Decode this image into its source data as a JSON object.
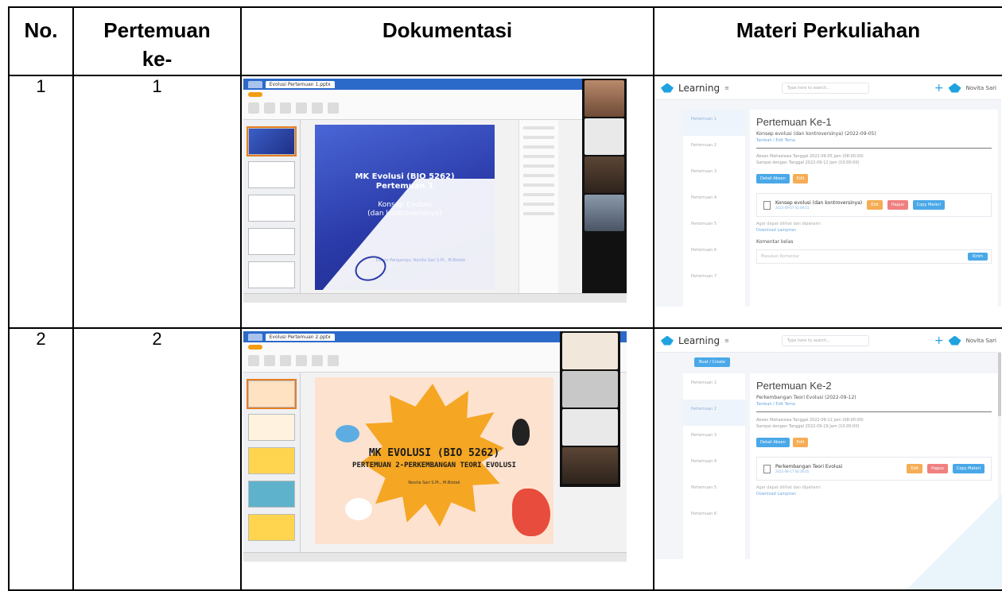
{
  "table": {
    "headers": {
      "no": "No.",
      "pertemuan": "Pertemuan ke-",
      "dokumentasi": "Dokumentasi",
      "materi": "Materi Perkuliahan"
    },
    "rows": [
      {
        "no": "1",
        "pertemuan": "1",
        "dok": {
          "tab_title": "Evolusi Pertemuan 1.pptx",
          "slide_title": "MK Evolusi (BIO 5262)",
          "slide_subtitle": "Pertemuan 1",
          "slide_topic": "Konsep Evolusi",
          "slide_topic2": "(dan kontroversinya)",
          "slide_footer": "Dosen Pengampu: Novita Sari S.Pt., M.Biotek"
        },
        "lms": {
          "brand": "Learning",
          "search_placeholder": "Type here to search...",
          "user": "Novita Sari",
          "heading": "Pertemuan Ke-1",
          "topic": "Konsep evolusi (dan kontroversinya) (2022-09-05)",
          "edit_link": "Tambah / Edit Tema",
          "absen_line1": "Absen Mahasiswa Tanggal 2022-09-05 Jam (08:00:00)",
          "absen_line2": "Sampai dengan Tanggal 2022-09-12 Jam (10:00:00)",
          "btn_detail": "Detail Absen",
          "btn_edit": "Edit",
          "materi_title": "Konsep evolusi (dan kontroversinya)",
          "materi_date": "2022-09-07 05:09:51",
          "btn_edit_materi": "Edit",
          "btn_hapus": "Hapus",
          "btn_copy": "Copy Materi",
          "note": "Agar dapat dilihat dan dipahami",
          "download": "Download Lampiran",
          "komentar": "Komentar kelas",
          "komentar_placeholder": "Masukan Komentar",
          "btn_kirim": "Kirim",
          "sidebar": [
            "Pertemuan 1",
            "Pertemuan 2",
            "Pertemuan 3",
            "Pertemuan 4",
            "Pertemuan 5",
            "Pertemuan 6",
            "Pertemuan 7"
          ]
        }
      },
      {
        "no": "2",
        "pertemuan": "2",
        "dok": {
          "tab_title": "Evolusi Pertemuan 2.pptx",
          "slide_title": "MK EVOLUSI (BIO 5262)",
          "slide_subtitle": "PERTEMUAN 2-PERKEMBANGAN TEORI EVOLUSI",
          "slide_footer": "Novita Sari S.Pt., M.Biotek"
        },
        "lms": {
          "brand": "Learning",
          "search_placeholder": "Type here to search...",
          "user": "Novita Sari",
          "create": "Buat / Create",
          "heading": "Pertemuan Ke-2",
          "topic": "Perkembangan Teori Evolusi (2022-09-12)",
          "edit_link": "Tambah / Edit Tema",
          "absen_line1": "Absen Mahasiswa Tanggal 2022-09-12 Jam (08:00:00)",
          "absen_line2": "Sampai dengan Tanggal 2022-09-19 Jam (10:00:00)",
          "btn_detail": "Detail Absen",
          "btn_edit": "Edit",
          "materi_title": "Perkembangan Teori Evolusi",
          "materi_date": "2022-09-17 06:26:05",
          "btn_edit_materi": "Edit",
          "btn_hapus": "Hapus",
          "btn_copy": "Copy Materi",
          "note": "Agar dapat dilihat dan dipahami",
          "download": "Download Lampiran",
          "sidebar": [
            "Pertemuan 1",
            "Pertemuan 2",
            "Pertemuan 3",
            "Pertemuan 4",
            "Pertemuan 5",
            "Pertemuan 6"
          ]
        }
      }
    ]
  },
  "colors": {
    "border": "#000000",
    "lms_accent": "#1fa3e0",
    "slide1_bg": "#2a3aa8",
    "slide2_bg": "#fde2cf",
    "slide2_sun": "#f5a623"
  }
}
